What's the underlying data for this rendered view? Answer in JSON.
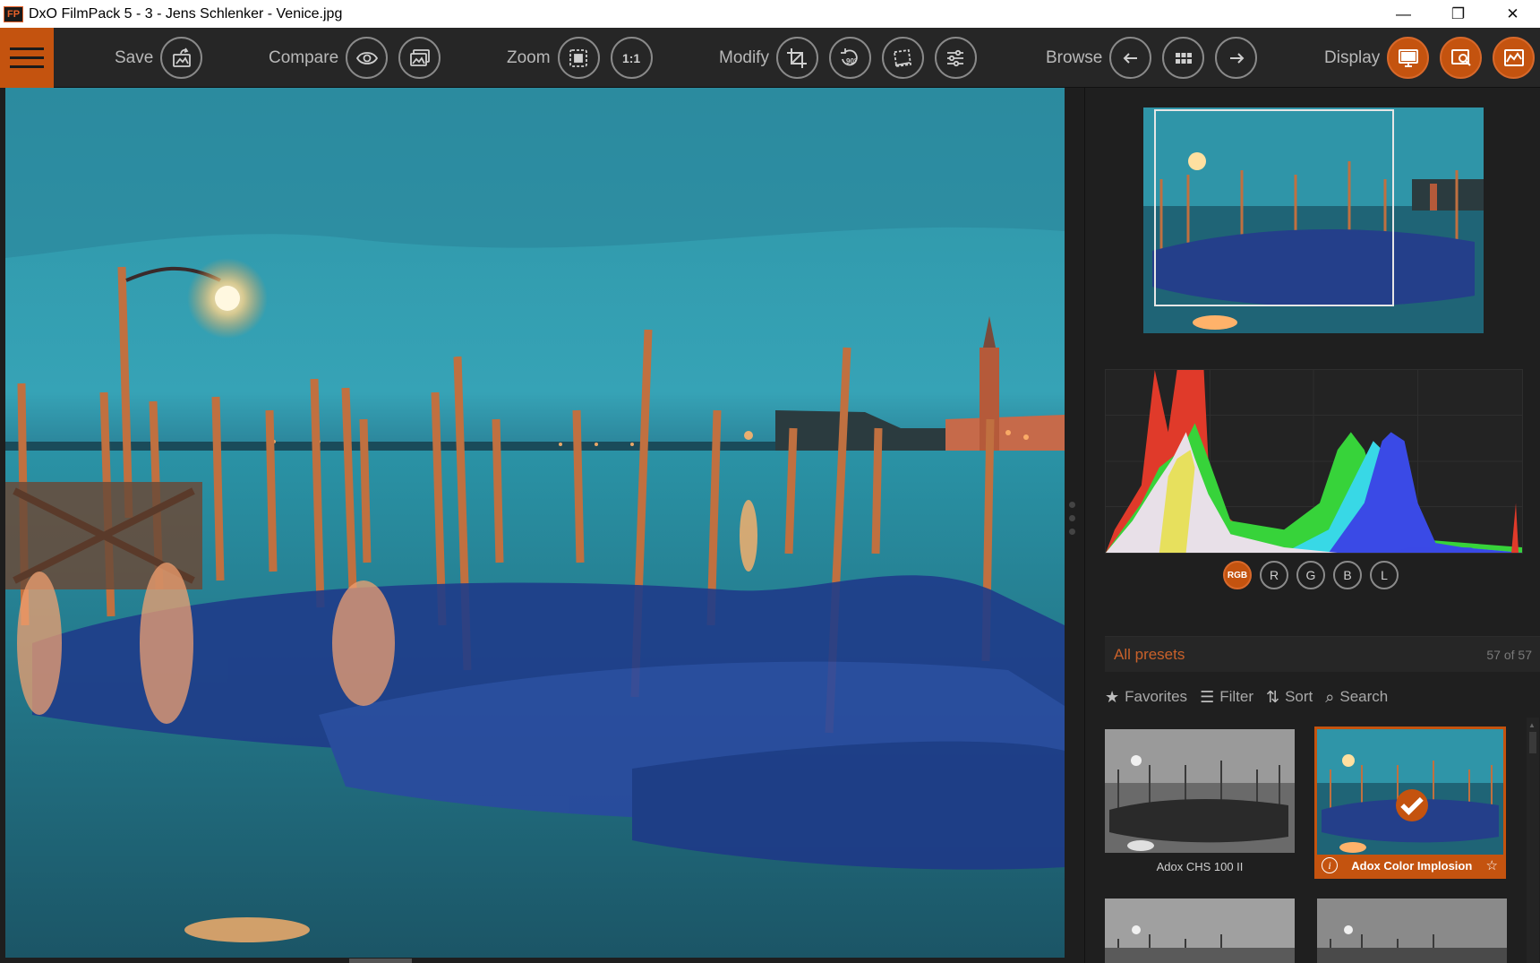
{
  "window": {
    "app_icon_text": "FP",
    "title": "DxO FilmPack 5 - 3 - Jens Schlenker - Venice.jpg",
    "controls": {
      "minimize": "—",
      "restore": "❐",
      "close": "✕"
    }
  },
  "toolbar": {
    "save_label": "Save",
    "compare_label": "Compare",
    "zoom_label": "Zoom",
    "zoom_one_to_one": "1:1",
    "modify_label": "Modify",
    "rotate_label": "90°",
    "browse_label": "Browse",
    "display_label": "Display"
  },
  "histogram": {
    "buttons": [
      "RGB",
      "R",
      "G",
      "B",
      "L"
    ],
    "active": "RGB"
  },
  "presets": {
    "header_title": "All presets",
    "count": "57 of 57",
    "tools": {
      "favorites": "Favorites",
      "filter": "Filter",
      "sort": "Sort",
      "search": "Search"
    },
    "items": [
      {
        "name": "Adox CHS 100 II",
        "selected": false
      },
      {
        "name": "Adox Color Implosion",
        "selected": true
      }
    ]
  },
  "colors": {
    "accent": "#c4530f",
    "toolbar_bg": "#262626",
    "panel_bg": "#1f1f1f"
  }
}
